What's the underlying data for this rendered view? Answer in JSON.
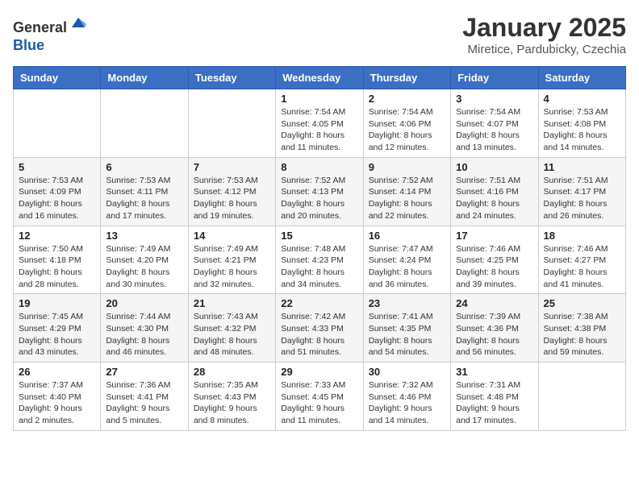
{
  "header": {
    "logo_line1": "General",
    "logo_line2": "Blue",
    "month_title": "January 2025",
    "subtitle": "Miretice, Pardubicky, Czechia"
  },
  "days_of_week": [
    "Sunday",
    "Monday",
    "Tuesday",
    "Wednesday",
    "Thursday",
    "Friday",
    "Saturday"
  ],
  "weeks": [
    [
      {
        "day": "",
        "sunrise": "",
        "sunset": "",
        "daylight": ""
      },
      {
        "day": "",
        "sunrise": "",
        "sunset": "",
        "daylight": ""
      },
      {
        "day": "",
        "sunrise": "",
        "sunset": "",
        "daylight": ""
      },
      {
        "day": "1",
        "sunrise": "Sunrise: 7:54 AM",
        "sunset": "Sunset: 4:05 PM",
        "daylight": "Daylight: 8 hours and 11 minutes."
      },
      {
        "day": "2",
        "sunrise": "Sunrise: 7:54 AM",
        "sunset": "Sunset: 4:06 PM",
        "daylight": "Daylight: 8 hours and 12 minutes."
      },
      {
        "day": "3",
        "sunrise": "Sunrise: 7:54 AM",
        "sunset": "Sunset: 4:07 PM",
        "daylight": "Daylight: 8 hours and 13 minutes."
      },
      {
        "day": "4",
        "sunrise": "Sunrise: 7:53 AM",
        "sunset": "Sunset: 4:08 PM",
        "daylight": "Daylight: 8 hours and 14 minutes."
      }
    ],
    [
      {
        "day": "5",
        "sunrise": "Sunrise: 7:53 AM",
        "sunset": "Sunset: 4:09 PM",
        "daylight": "Daylight: 8 hours and 16 minutes."
      },
      {
        "day": "6",
        "sunrise": "Sunrise: 7:53 AM",
        "sunset": "Sunset: 4:11 PM",
        "daylight": "Daylight: 8 hours and 17 minutes."
      },
      {
        "day": "7",
        "sunrise": "Sunrise: 7:53 AM",
        "sunset": "Sunset: 4:12 PM",
        "daylight": "Daylight: 8 hours and 19 minutes."
      },
      {
        "day": "8",
        "sunrise": "Sunrise: 7:52 AM",
        "sunset": "Sunset: 4:13 PM",
        "daylight": "Daylight: 8 hours and 20 minutes."
      },
      {
        "day": "9",
        "sunrise": "Sunrise: 7:52 AM",
        "sunset": "Sunset: 4:14 PM",
        "daylight": "Daylight: 8 hours and 22 minutes."
      },
      {
        "day": "10",
        "sunrise": "Sunrise: 7:51 AM",
        "sunset": "Sunset: 4:16 PM",
        "daylight": "Daylight: 8 hours and 24 minutes."
      },
      {
        "day": "11",
        "sunrise": "Sunrise: 7:51 AM",
        "sunset": "Sunset: 4:17 PM",
        "daylight": "Daylight: 8 hours and 26 minutes."
      }
    ],
    [
      {
        "day": "12",
        "sunrise": "Sunrise: 7:50 AM",
        "sunset": "Sunset: 4:18 PM",
        "daylight": "Daylight: 8 hours and 28 minutes."
      },
      {
        "day": "13",
        "sunrise": "Sunrise: 7:49 AM",
        "sunset": "Sunset: 4:20 PM",
        "daylight": "Daylight: 8 hours and 30 minutes."
      },
      {
        "day": "14",
        "sunrise": "Sunrise: 7:49 AM",
        "sunset": "Sunset: 4:21 PM",
        "daylight": "Daylight: 8 hours and 32 minutes."
      },
      {
        "day": "15",
        "sunrise": "Sunrise: 7:48 AM",
        "sunset": "Sunset: 4:23 PM",
        "daylight": "Daylight: 8 hours and 34 minutes."
      },
      {
        "day": "16",
        "sunrise": "Sunrise: 7:47 AM",
        "sunset": "Sunset: 4:24 PM",
        "daylight": "Daylight: 8 hours and 36 minutes."
      },
      {
        "day": "17",
        "sunrise": "Sunrise: 7:46 AM",
        "sunset": "Sunset: 4:25 PM",
        "daylight": "Daylight: 8 hours and 39 minutes."
      },
      {
        "day": "18",
        "sunrise": "Sunrise: 7:46 AM",
        "sunset": "Sunset: 4:27 PM",
        "daylight": "Daylight: 8 hours and 41 minutes."
      }
    ],
    [
      {
        "day": "19",
        "sunrise": "Sunrise: 7:45 AM",
        "sunset": "Sunset: 4:29 PM",
        "daylight": "Daylight: 8 hours and 43 minutes."
      },
      {
        "day": "20",
        "sunrise": "Sunrise: 7:44 AM",
        "sunset": "Sunset: 4:30 PM",
        "daylight": "Daylight: 8 hours and 46 minutes."
      },
      {
        "day": "21",
        "sunrise": "Sunrise: 7:43 AM",
        "sunset": "Sunset: 4:32 PM",
        "daylight": "Daylight: 8 hours and 48 minutes."
      },
      {
        "day": "22",
        "sunrise": "Sunrise: 7:42 AM",
        "sunset": "Sunset: 4:33 PM",
        "daylight": "Daylight: 8 hours and 51 minutes."
      },
      {
        "day": "23",
        "sunrise": "Sunrise: 7:41 AM",
        "sunset": "Sunset: 4:35 PM",
        "daylight": "Daylight: 8 hours and 54 minutes."
      },
      {
        "day": "24",
        "sunrise": "Sunrise: 7:39 AM",
        "sunset": "Sunset: 4:36 PM",
        "daylight": "Daylight: 8 hours and 56 minutes."
      },
      {
        "day": "25",
        "sunrise": "Sunrise: 7:38 AM",
        "sunset": "Sunset: 4:38 PM",
        "daylight": "Daylight: 8 hours and 59 minutes."
      }
    ],
    [
      {
        "day": "26",
        "sunrise": "Sunrise: 7:37 AM",
        "sunset": "Sunset: 4:40 PM",
        "daylight": "Daylight: 9 hours and 2 minutes."
      },
      {
        "day": "27",
        "sunrise": "Sunrise: 7:36 AM",
        "sunset": "Sunset: 4:41 PM",
        "daylight": "Daylight: 9 hours and 5 minutes."
      },
      {
        "day": "28",
        "sunrise": "Sunrise: 7:35 AM",
        "sunset": "Sunset: 4:43 PM",
        "daylight": "Daylight: 9 hours and 8 minutes."
      },
      {
        "day": "29",
        "sunrise": "Sunrise: 7:33 AM",
        "sunset": "Sunset: 4:45 PM",
        "daylight": "Daylight: 9 hours and 11 minutes."
      },
      {
        "day": "30",
        "sunrise": "Sunrise: 7:32 AM",
        "sunset": "Sunset: 4:46 PM",
        "daylight": "Daylight: 9 hours and 14 minutes."
      },
      {
        "day": "31",
        "sunrise": "Sunrise: 7:31 AM",
        "sunset": "Sunset: 4:48 PM",
        "daylight": "Daylight: 9 hours and 17 minutes."
      },
      {
        "day": "",
        "sunrise": "",
        "sunset": "",
        "daylight": ""
      }
    ]
  ]
}
